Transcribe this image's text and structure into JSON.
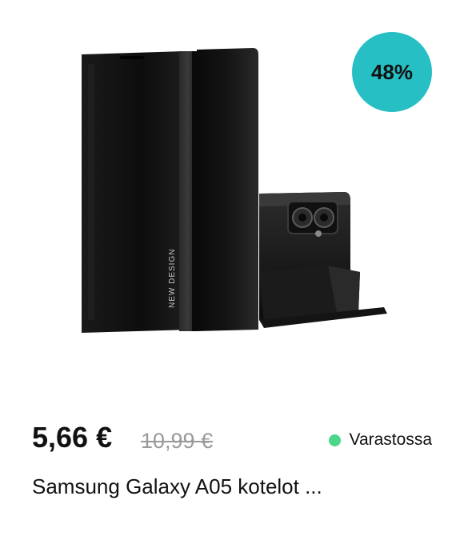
{
  "badge": {
    "discount": "48%"
  },
  "price": {
    "current": "5,66 €",
    "old": "10,99 €"
  },
  "stock": {
    "label": "Varastossa",
    "color": "#4cd68a"
  },
  "product": {
    "title": "Samsung Galaxy A05 kotelot ...",
    "case_print": "NEW DESIGN"
  },
  "colors": {
    "badge": "#26bfc4",
    "old_price": "#9a9a9a"
  }
}
